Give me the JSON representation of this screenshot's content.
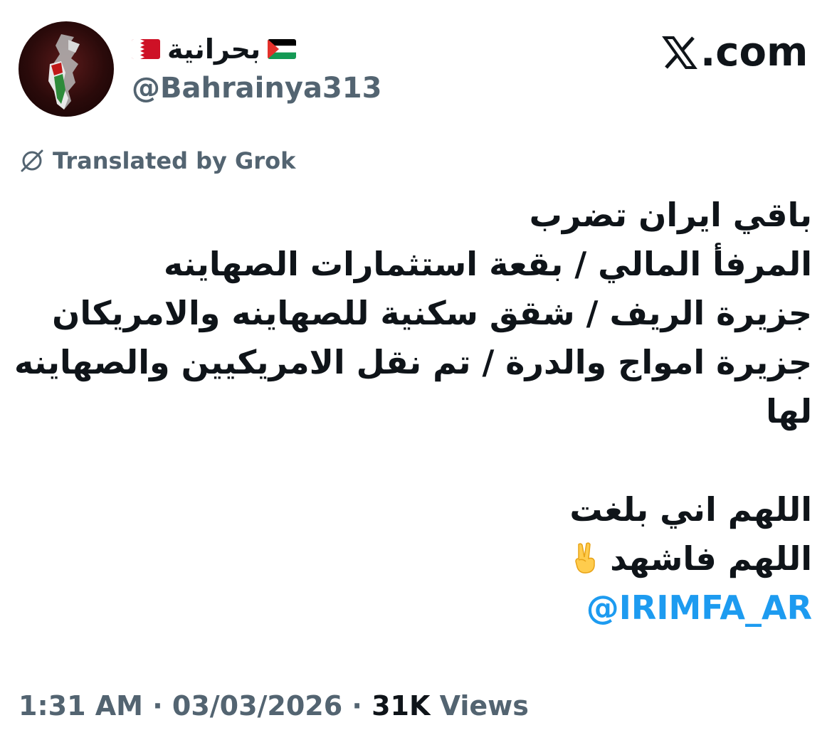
{
  "header": {
    "display_name": "بحرانية",
    "handle": "@Bahrainya313",
    "site": ".com"
  },
  "icons": {
    "flag_left": "palestine-flag",
    "flag_right": "bahrain-flag",
    "site_logo": "x-logo",
    "translation": "grok-icon",
    "emoji": "victory-hand"
  },
  "translation_label": "Translated by Grok",
  "tweet": {
    "lines": [
      "باقي ايران تضرب",
      "المرفأ المالي / بقعة استثمارات الصهاينه",
      "جزيرة الريف / شقق سكنية للصهاينه والامريكان",
      "جزيرة امواج والدرة / تم نقل الامريكيين والصهاينه",
      "لها",
      "",
      "اللهم اني بلغت",
      "اللهم فاشهد"
    ],
    "mention": "@IRIMFA_AR"
  },
  "meta": {
    "time": "1:31 AM",
    "separator": "·",
    "date": "03/03/2026",
    "views_count": "31K",
    "views_label": "Views"
  },
  "colors": {
    "text": "#0f1419",
    "secondary": "#536471",
    "link": "#1d9bf0"
  }
}
